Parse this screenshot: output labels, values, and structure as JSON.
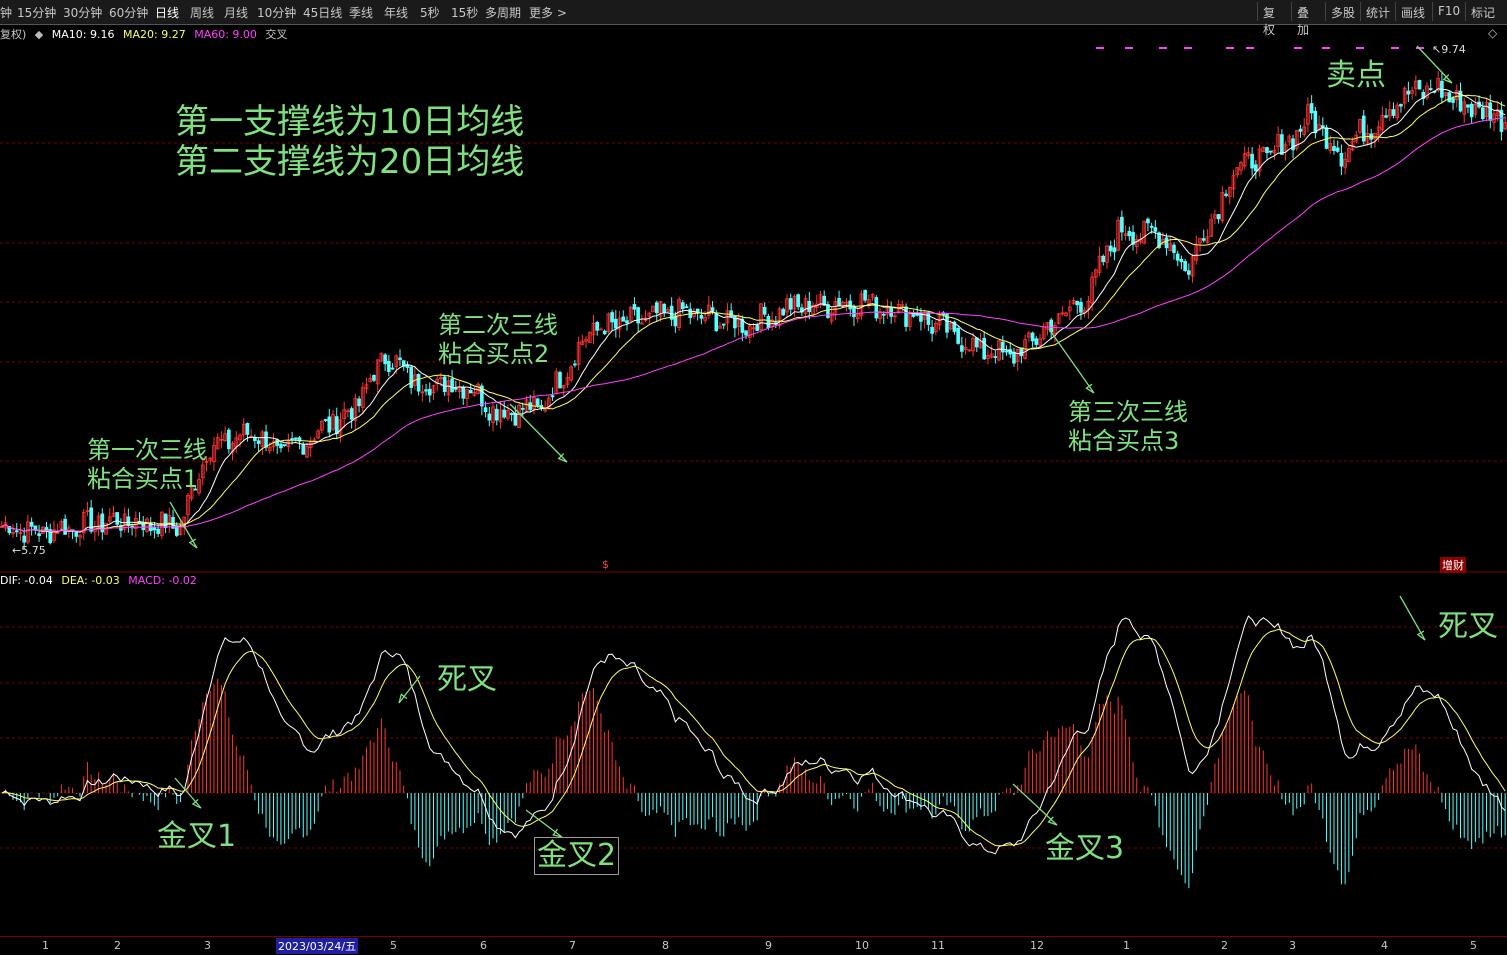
{
  "toolbar": {
    "periods": [
      "钟",
      "15分钟",
      "30分钟",
      "60分钟",
      "日线",
      "周线",
      "月线",
      "10分钟",
      "45日线",
      "季线",
      "年线",
      "5秒",
      "15秒",
      "多周期",
      "更多 >"
    ],
    "active_period": "日线",
    "tools": [
      "复权",
      "叠加",
      "多股",
      "统计",
      "画线",
      "F10",
      "标记"
    ]
  },
  "price_legend": {
    "prefix": "复权)",
    "ma10": "MA10: 9.16",
    "ma20": "MA20: 9.27",
    "ma60": "MA60: 9.00",
    "extra": "交叉"
  },
  "macd_legend": {
    "dif": "DIF: -0.04",
    "dea": "DEA: -0.03",
    "macd": "MACD: -0.02"
  },
  "markers": {
    "high": "9.74",
    "low": "5.75",
    "dollar": "$",
    "zengcai": "增财"
  },
  "annotations": {
    "support_line1": "第一支撑线为10日均线",
    "support_line2": "第二支撑线为20日均线",
    "buy1_line1": "第一次三线",
    "buy1_line2": "粘合买点1",
    "buy2_line1": "第二次三线",
    "buy2_line2": "粘合买点2",
    "buy3_line1": "第三次三线",
    "buy3_line2": "粘合买点3",
    "sell": "卖点",
    "dead_cross_1": "死叉",
    "dead_cross_2": "死叉",
    "golden_cross_1": "金叉1",
    "golden_cross_2": "金叉2",
    "golden_cross_3": "金叉3"
  },
  "time_axis": {
    "ticks": [
      "1",
      "2",
      "3",
      "4",
      "5",
      "6",
      "7",
      "8",
      "9",
      "10",
      "11",
      "12",
      "1",
      "2",
      "3",
      "4",
      "5"
    ],
    "cursor_date": "2023/03/24/五"
  },
  "colors": {
    "up": "#ff3333",
    "down": "#54ffff",
    "ma10": "#ffffff",
    "ma20": "#ffff66",
    "ma60": "#ff40ff",
    "annotation": "#7fe07f",
    "grid": "#7a0000"
  },
  "chart_data": {
    "type": "candlestick",
    "price_waypoints": [
      {
        "t": 0,
        "close": 5.85
      },
      {
        "t": 10,
        "close": 5.8
      },
      {
        "t": 30,
        "close": 5.9
      },
      {
        "t": 48,
        "close": 5.85
      },
      {
        "t": 55,
        "close": 6.5
      },
      {
        "t": 68,
        "close": 6.65
      },
      {
        "t": 75,
        "close": 6.45
      },
      {
        "t": 95,
        "close": 6.85
      },
      {
        "t": 103,
        "close": 7.3
      },
      {
        "t": 112,
        "close": 7.05
      },
      {
        "t": 125,
        "close": 7.05
      },
      {
        "t": 133,
        "close": 6.82
      },
      {
        "t": 145,
        "close": 6.85
      },
      {
        "t": 158,
        "close": 7.5
      },
      {
        "t": 182,
        "close": 7.65
      },
      {
        "t": 200,
        "close": 7.55
      },
      {
        "t": 212,
        "close": 7.7
      },
      {
        "t": 230,
        "close": 7.75
      },
      {
        "t": 245,
        "close": 7.65
      },
      {
        "t": 262,
        "close": 7.35
      },
      {
        "t": 272,
        "close": 7.28
      },
      {
        "t": 280,
        "close": 7.5
      },
      {
        "t": 292,
        "close": 7.8
      },
      {
        "t": 300,
        "close": 8.35
      },
      {
        "t": 313,
        "close": 8.3
      },
      {
        "t": 318,
        "close": 8.0
      },
      {
        "t": 332,
        "close": 8.9
      },
      {
        "t": 340,
        "close": 8.95
      },
      {
        "t": 352,
        "close": 9.3
      },
      {
        "t": 360,
        "close": 9.0
      },
      {
        "t": 375,
        "close": 9.45
      },
      {
        "t": 385,
        "close": 9.55
      },
      {
        "t": 393,
        "close": 9.4
      },
      {
        "t": 404,
        "close": 9.3
      }
    ],
    "bars": 405,
    "moving_averages": [
      {
        "name": "MA10",
        "period": 10
      },
      {
        "name": "MA20",
        "period": 20
      },
      {
        "name": "MA60",
        "period": 60
      }
    ],
    "price_range": [
      5.6,
      9.9
    ],
    "macd_range": [
      -0.3,
      0.36
    ],
    "price_high": 9.74,
    "price_low": 5.75
  }
}
